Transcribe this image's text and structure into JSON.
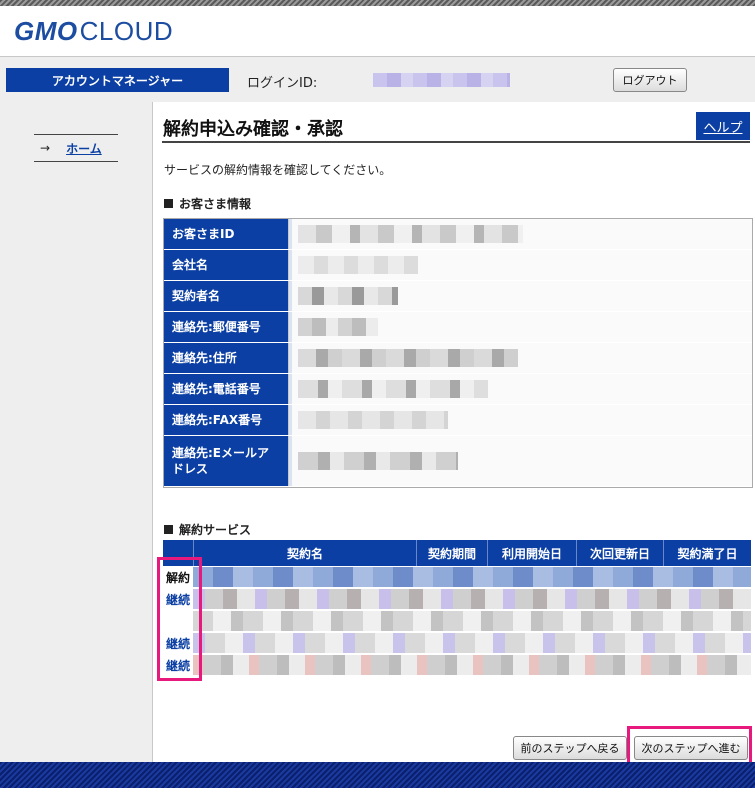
{
  "header": {
    "logo_gmo": "GMO",
    "logo_cloud": "CLOUD"
  },
  "subheader": {
    "account_tab": "アカウントマネージャー",
    "login_label": "ログインID:",
    "logout_button": "ログアウト"
  },
  "sidebar": {
    "arrow": "→",
    "home": "ホーム"
  },
  "main": {
    "title": "解約申込み確認・承認",
    "help": "ヘルプ",
    "intro": "サービスの解約情報を確認してください。",
    "customer_section_title": "お客さま情報",
    "customer_fields": [
      "お客さまID",
      "会社名",
      "契約者名",
      "連絡先:郵便番号",
      "連絡先:住所",
      "連絡先:電話番号",
      "連絡先:FAX番号",
      "連絡先:Eメールアドレス"
    ],
    "service_section_title": "解約サービス",
    "service_columns": [
      "契約名",
      "契約期間",
      "利用開始日",
      "次回更新日",
      "契約満了日"
    ],
    "service_rows": [
      {
        "status": "解約"
      },
      {
        "status": "継続"
      },
      {
        "status": ""
      },
      {
        "status": "継続"
      },
      {
        "status": "継続"
      }
    ],
    "prev_button": "前のステップへ戻る",
    "next_button": "次のステップへ進む"
  },
  "colors": {
    "brand_blue": "#0b3fa3",
    "highlight_pink": "#e8197d"
  }
}
